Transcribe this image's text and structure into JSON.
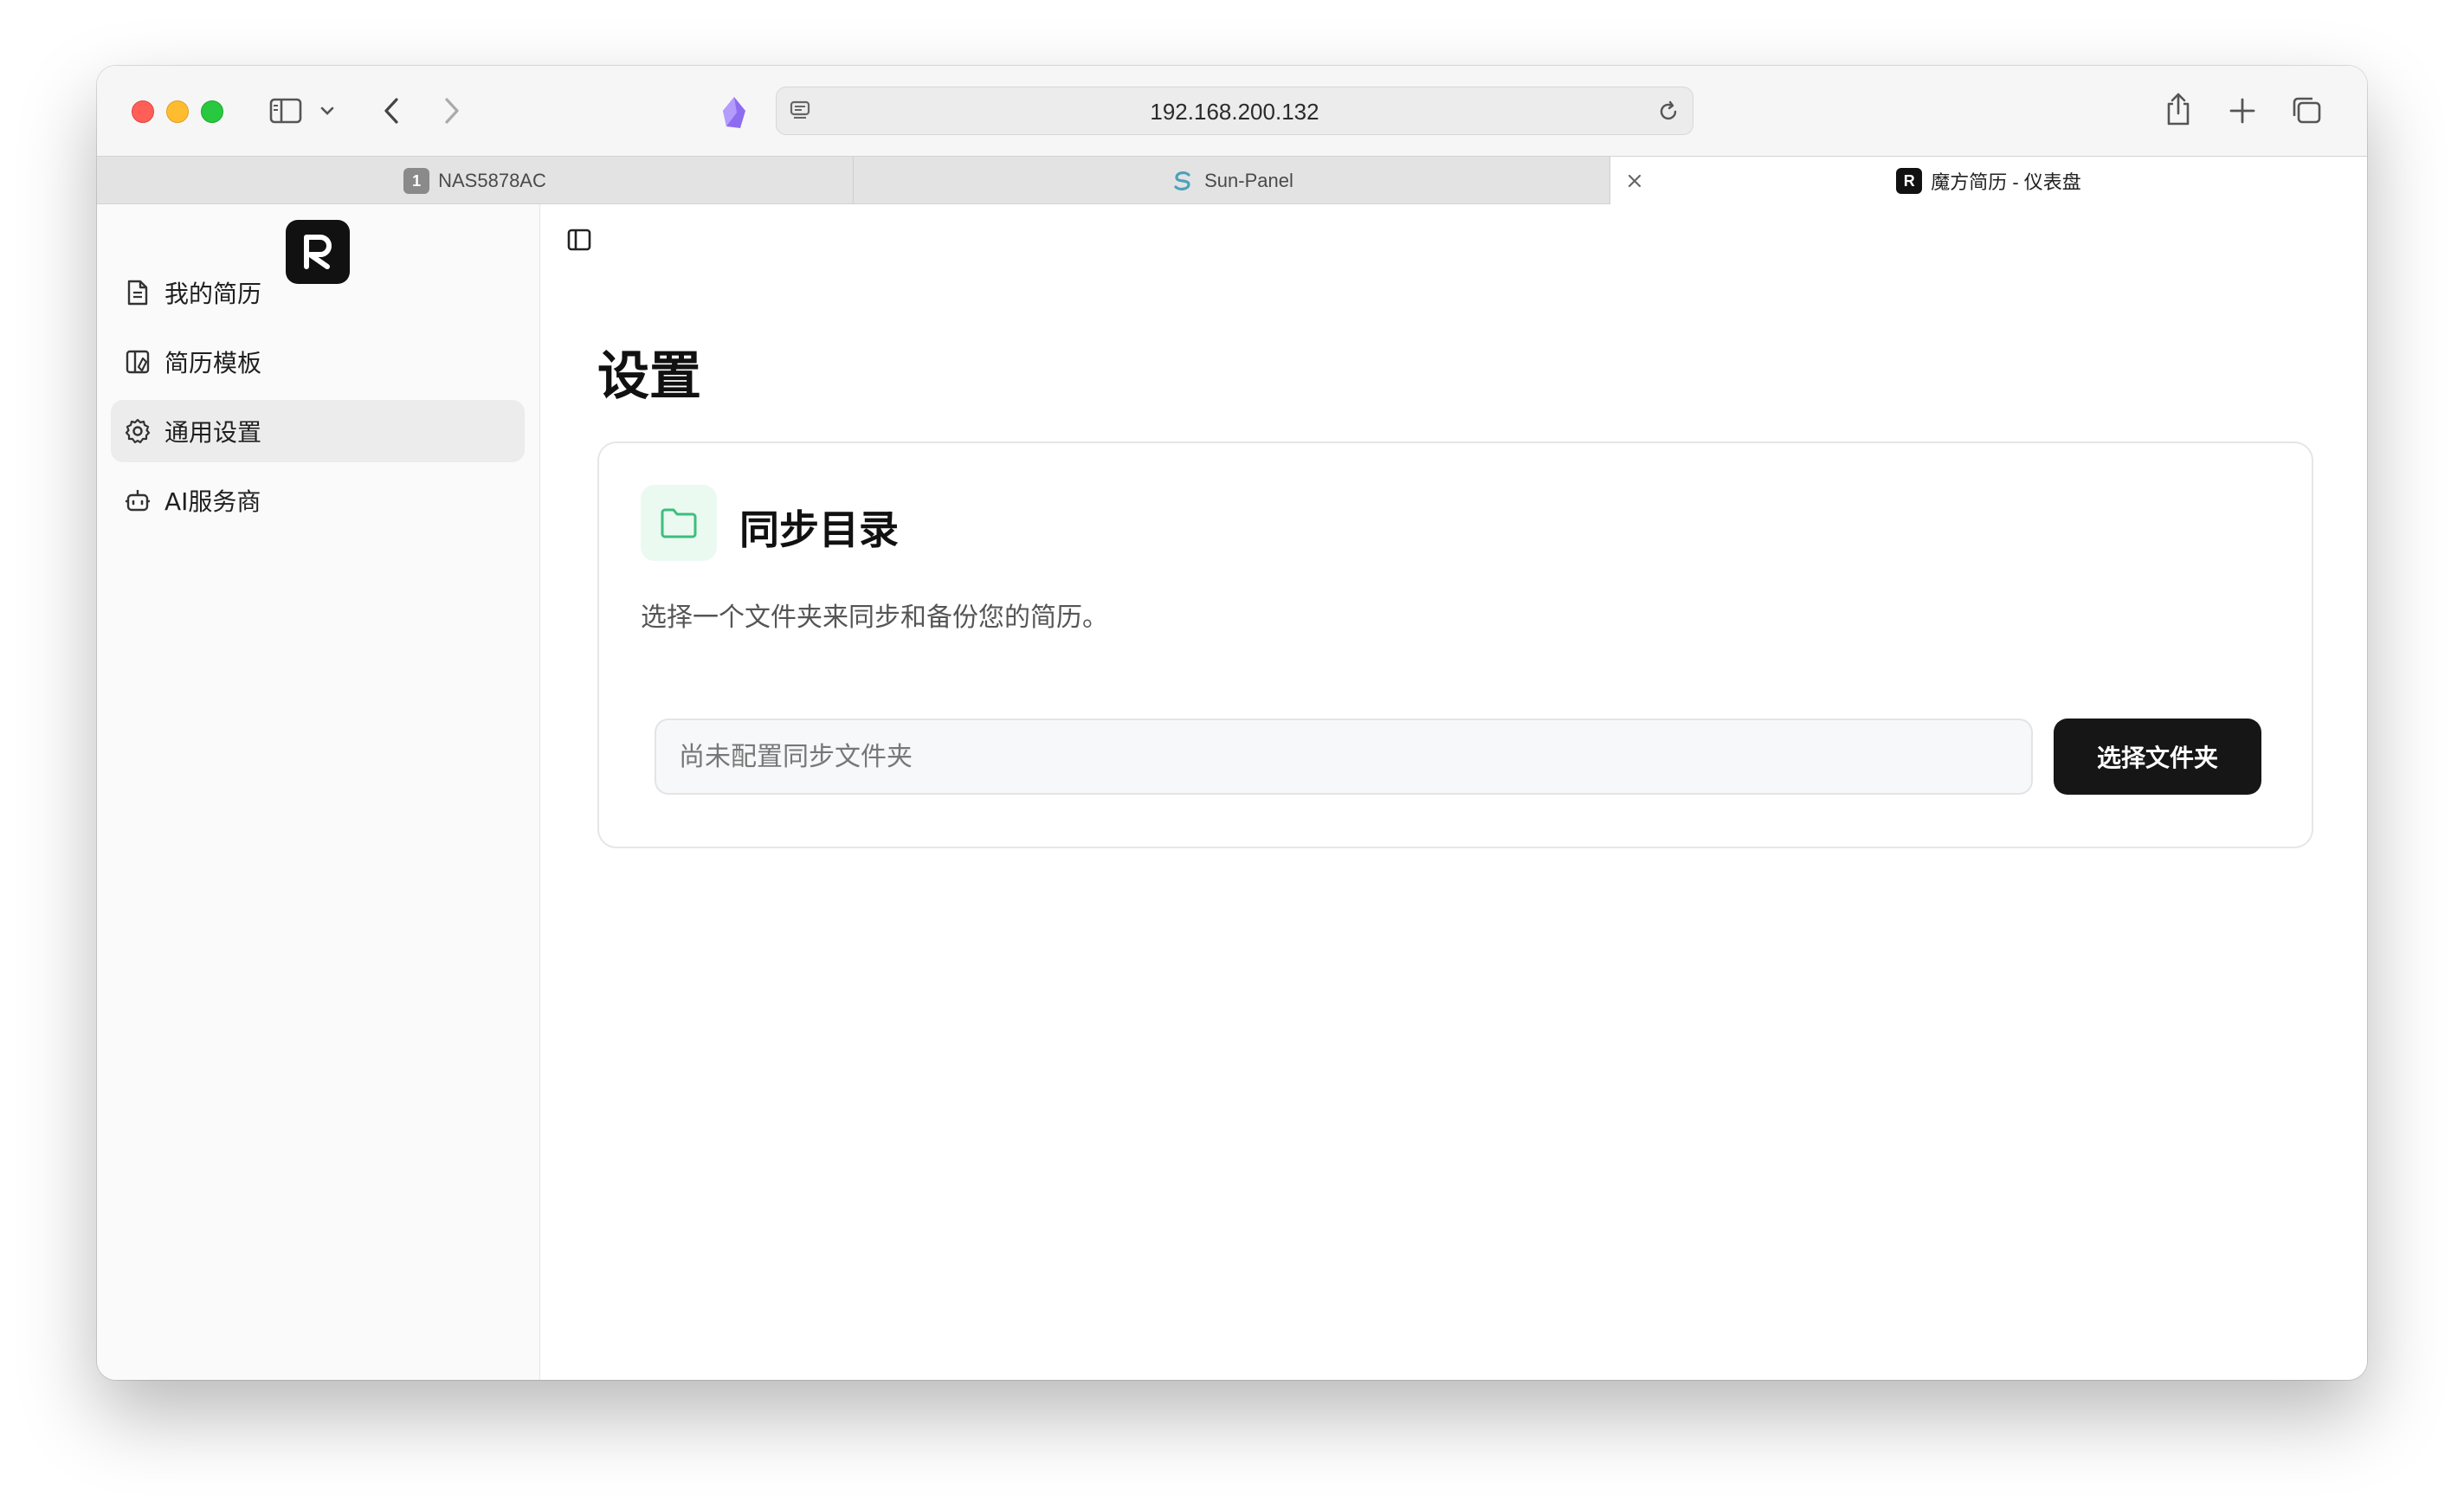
{
  "browser": {
    "url": "192.168.200.132",
    "tabs": [
      {
        "label": "NAS5878AC",
        "favicon_text": "1",
        "favicon_color": "#8a8a8a"
      },
      {
        "label": "Sun-Panel",
        "favicon_text": "S",
        "favicon_color": "#4aa3b8"
      },
      {
        "label": "魔方简历 - 仪表盘",
        "favicon_text": "R",
        "favicon_color": "#111111",
        "active": true
      }
    ]
  },
  "sidebar": {
    "logo_text": "R",
    "items": [
      {
        "label": "我的简历",
        "icon": "document-icon"
      },
      {
        "label": "简历模板",
        "icon": "template-icon"
      },
      {
        "label": "通用设置",
        "icon": "gear-icon",
        "active": true
      },
      {
        "label": "AI服务商",
        "icon": "bot-icon"
      }
    ]
  },
  "main": {
    "title": "设置",
    "card": {
      "title": "同步目录",
      "description": "选择一个文件夹来同步和备份您的简历。",
      "input_placeholder": "尚未配置同步文件夹",
      "input_value": "",
      "button_label": "选择文件夹"
    }
  },
  "colors": {
    "accent_green": "#3ebd7e",
    "button_dark": "#161616"
  }
}
